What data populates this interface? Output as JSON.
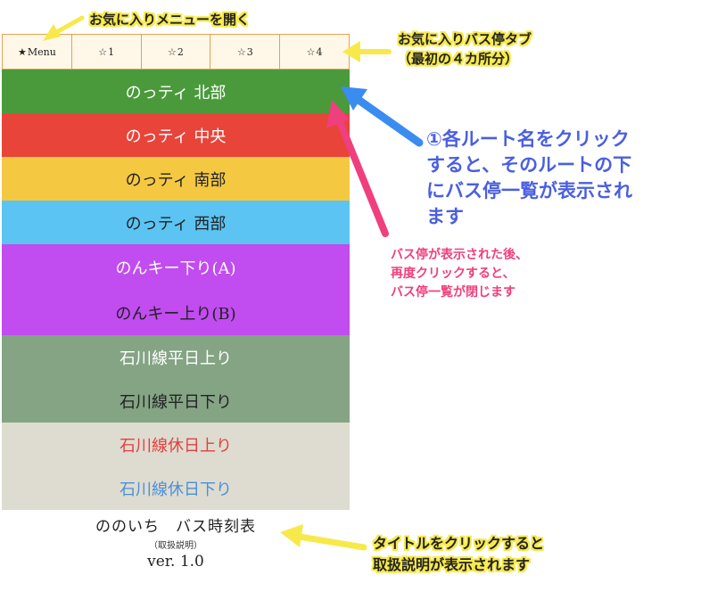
{
  "tabs": [
    {
      "glyph": "★",
      "label": "Menu"
    },
    {
      "glyph": "☆",
      "label": "1"
    },
    {
      "glyph": "☆",
      "label": "2"
    },
    {
      "glyph": "☆",
      "label": "3"
    },
    {
      "glyph": "☆",
      "label": "4"
    }
  ],
  "routes": [
    {
      "label": "のっティ 北部",
      "bg": "#4a9a3c",
      "fg": "#ffffff"
    },
    {
      "label": "のっティ 中央",
      "bg": "#e8443a",
      "fg": "#ffffff"
    },
    {
      "label": "のっティ 南部",
      "bg": "#f5c842",
      "fg": "#222222"
    },
    {
      "label": "のっティ 西部",
      "bg": "#5bc4f2",
      "fg": "#222222"
    },
    {
      "label": "のんキー下り(A)",
      "bg": "#c14cf0",
      "fg": "#ffffff"
    },
    {
      "label": "のんキー上り(B)",
      "bg": "#c14cf0",
      "fg": "#222222"
    },
    {
      "label": "石川線平日上り",
      "bg": "#84a484",
      "fg": "#ffffff"
    },
    {
      "label": "石川線平日下り",
      "bg": "#84a484",
      "fg": "#222222"
    },
    {
      "label": "石川線休日上り",
      "bg": "#dedcd0",
      "fg": "#e04040"
    },
    {
      "label": "石川線休日下り",
      "bg": "#dedcd0",
      "fg": "#4a90d8"
    }
  ],
  "footer": {
    "title": "ののいち　バス時刻表",
    "subtitle": "（取扱説明）",
    "version": "ver. 1.0"
  },
  "annotations": {
    "menu_note": "お気に入りメニューを開く",
    "tabs_note": [
      "お気に入りバス停タブ",
      "（最初の４カ所分）"
    ],
    "route_note": [
      "①各ルート名をクリック",
      "すると、そのルートの下",
      "にバス停一覧が表示され",
      "ます"
    ],
    "close_note": [
      "バス停が表示された後、",
      "再度クリックすると、",
      "バス停一覧が閉じます"
    ],
    "title_note": [
      "タイトルをクリックすると",
      "取扱説明が表示されます"
    ]
  },
  "colors": {
    "tab_border": "#e8a050",
    "tab_bg": "#fff8e8",
    "note_yellow": "#f7e94a",
    "note_blue": "#4a5fe0",
    "note_pink": "#ef3f7c"
  }
}
